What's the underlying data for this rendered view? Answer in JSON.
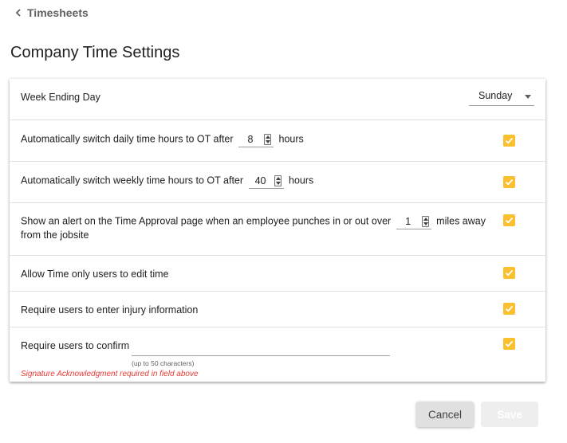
{
  "breadcrumb": {
    "back_label": "Timesheets"
  },
  "page": {
    "title": "Company Time Settings"
  },
  "settings": {
    "week_ending": {
      "label": "Week Ending Day",
      "value": "Sunday"
    },
    "daily_ot": {
      "prefix": "Automatically switch daily time hours to OT after",
      "value": "8",
      "suffix": "hours",
      "checked": true
    },
    "weekly_ot": {
      "prefix": "Automatically switch weekly time hours to OT after",
      "value": "40",
      "suffix": "hours",
      "checked": true
    },
    "punch_alert": {
      "prefix": "Show an alert on the Time Approval page when an employee punches in or out over",
      "value": "1",
      "suffix": "miles away",
      "line2": "from the jobsite",
      "checked": true
    },
    "time_only_edit": {
      "label": "Allow Time only users to edit time",
      "checked": true
    },
    "injury_info": {
      "label": "Require users to enter injury information",
      "checked": true
    },
    "confirm": {
      "label": "Require users to confirm",
      "value": "",
      "hint": "(up to 50 characters)",
      "error": "Signature Acknowledgment required in field above",
      "checked": true
    }
  },
  "actions": {
    "cancel_label": "Cancel",
    "save_label": "Save"
  },
  "colors": {
    "checkbox": "#fbc02d",
    "error": "#e53935",
    "cancel_bg": "#e0e0e0",
    "save_bg": "#eeeeee"
  },
  "icons": {
    "back": "chevron-left-icon",
    "dropdown": "caret-down-icon",
    "check": "check-icon",
    "spinner": "spinner-icon"
  }
}
